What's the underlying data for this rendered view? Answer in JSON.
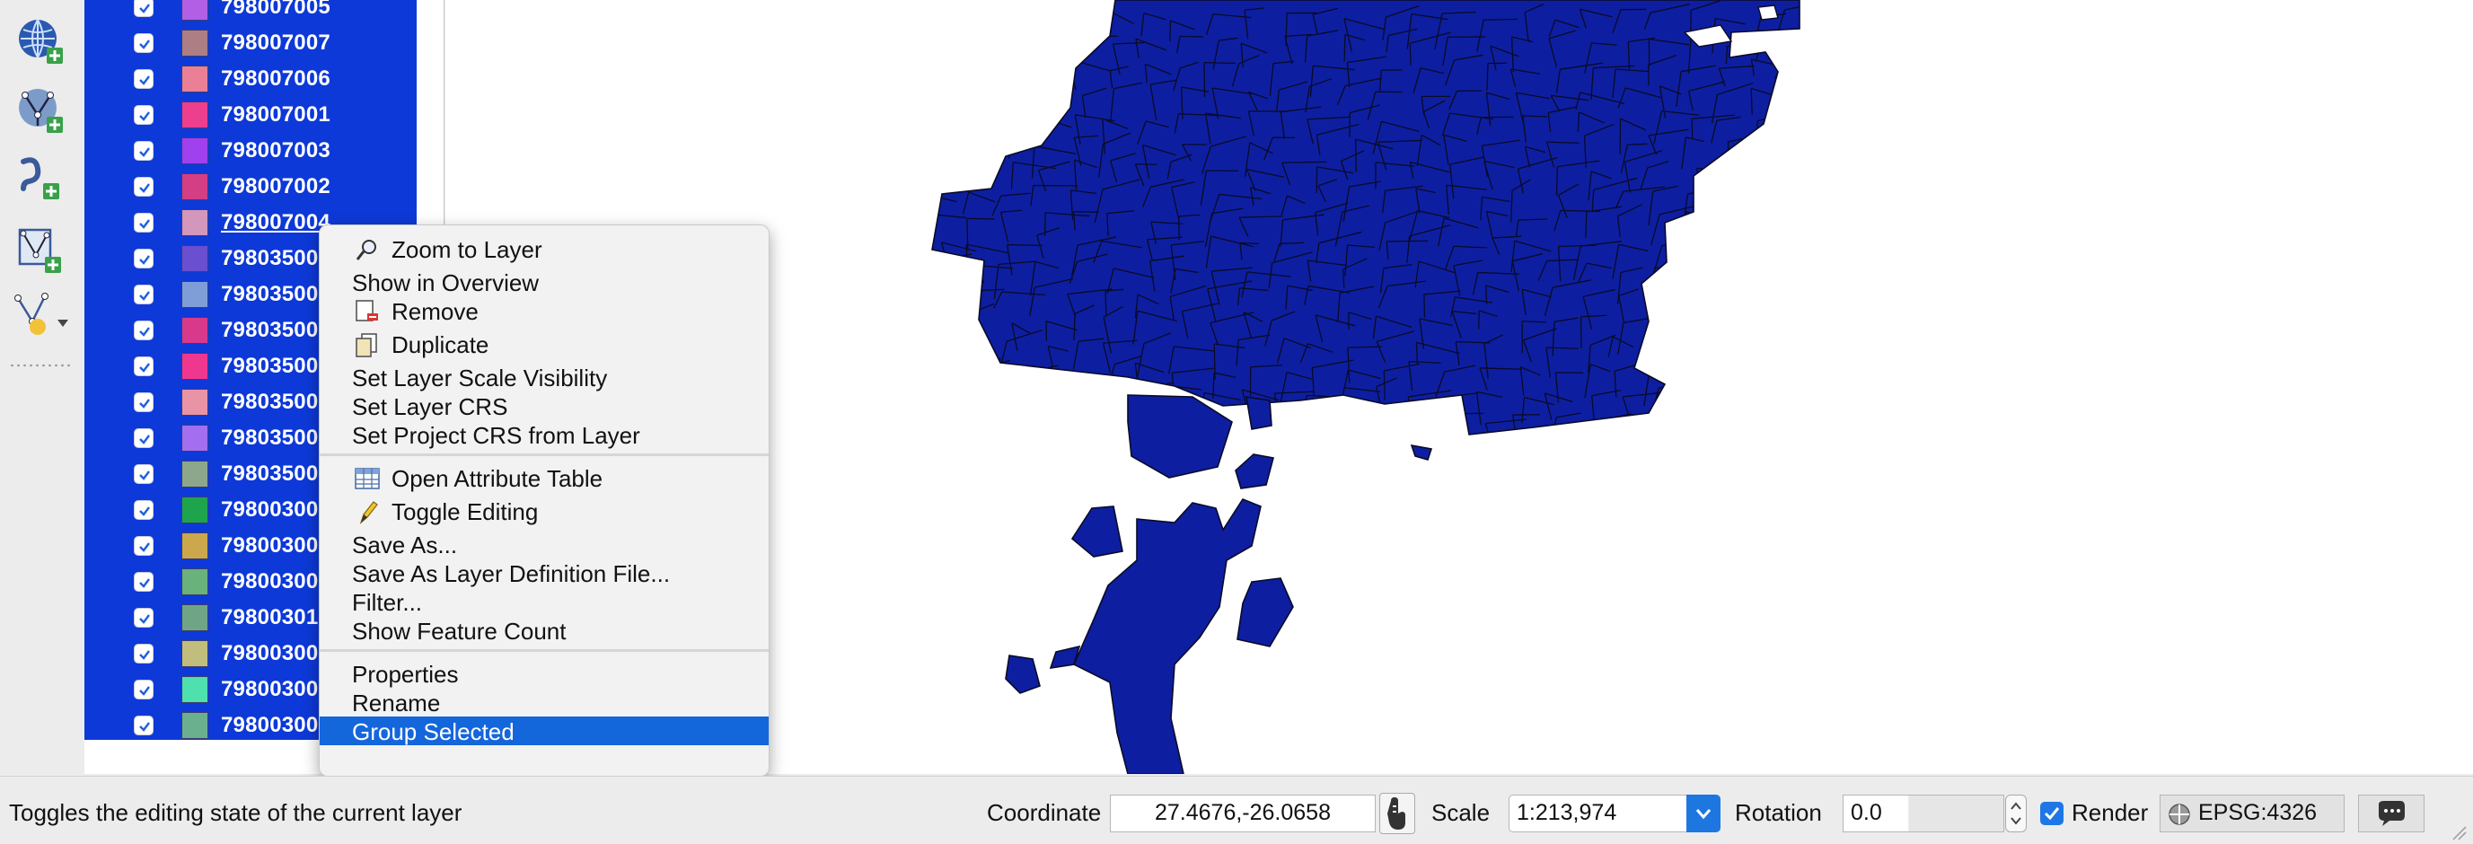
{
  "toolbar": {
    "tools": [
      {
        "name": "add-wms-layer-icon"
      },
      {
        "name": "add-wfs-layer-icon"
      },
      {
        "name": "add-delimited-text-layer-icon"
      },
      {
        "name": "add-spatialite-layer-icon"
      },
      {
        "name": "new-shapefile-layer-icon"
      }
    ]
  },
  "layers": {
    "rows": [
      {
        "label": "798007005",
        "color": "#b25fe6"
      },
      {
        "label": "798007007",
        "color": "#ad7f85"
      },
      {
        "label": "798007006",
        "color": "#ea7f95"
      },
      {
        "label": "798007001",
        "color": "#ee3e8e"
      },
      {
        "label": "798007003",
        "color": "#a140ee"
      },
      {
        "label": "798007002",
        "color": "#d43e84"
      },
      {
        "label": "798007004",
        "color": "#d396bd",
        "current": true
      },
      {
        "label": "79803500",
        "color": "#6a4fd0"
      },
      {
        "label": "79803500",
        "color": "#7f9ed8"
      },
      {
        "label": "79803500",
        "color": "#d8398b"
      },
      {
        "label": "79803500",
        "color": "#f0378f"
      },
      {
        "label": "79803500",
        "color": "#e994a6"
      },
      {
        "label": "79803500",
        "color": "#a36ff0"
      },
      {
        "label": "79803500",
        "color": "#8da78c"
      },
      {
        "label": "79800300",
        "color": "#1fa44e"
      },
      {
        "label": "79800300",
        "color": "#cba84b"
      },
      {
        "label": "79800300",
        "color": "#69b27c"
      },
      {
        "label": "79800301",
        "color": "#6fa586"
      },
      {
        "label": "79800300",
        "color": "#c1be7d"
      },
      {
        "label": "79800300",
        "color": "#4ee0ad"
      },
      {
        "label": "79800300",
        "color": "#6ab08e"
      }
    ]
  },
  "map": {
    "fill_color": "#0d1fa0",
    "stroke_color": "#0a0a28"
  },
  "context_menu": {
    "groups": [
      [
        {
          "label": "Zoom to Layer",
          "icon": "zoom-icon"
        },
        {
          "label": "Show in Overview"
        },
        {
          "label": "Remove",
          "icon": "remove-layer-icon"
        },
        {
          "label": "Duplicate",
          "icon": "duplicate-layer-icon"
        },
        {
          "label": "Set Layer Scale Visibility"
        },
        {
          "label": "Set Layer CRS"
        },
        {
          "label": "Set Project CRS from Layer"
        }
      ],
      [
        {
          "label": "Open Attribute Table",
          "icon": "attribute-table-icon"
        },
        {
          "label": "Toggle Editing",
          "icon": "pencil-icon"
        },
        {
          "label": "Save As..."
        },
        {
          "label": "Save As Layer Definition File..."
        },
        {
          "label": "Filter..."
        },
        {
          "label": "Show Feature Count"
        }
      ],
      [
        {
          "label": "Properties"
        },
        {
          "label": "Rename"
        },
        {
          "label": "Group Selected",
          "highlighted": true
        }
      ]
    ]
  },
  "statusbar": {
    "message": "Toggles the editing state of the current layer",
    "coordinate_label": "Coordinate",
    "coordinate_value": "27.4676,-26.0658",
    "scale_label": "Scale",
    "scale_value": "1:213,974",
    "rotation_label": "Rotation",
    "rotation_value": "0.0",
    "render_label": "Render",
    "render_checked": true,
    "crs": "EPSG:4326"
  }
}
